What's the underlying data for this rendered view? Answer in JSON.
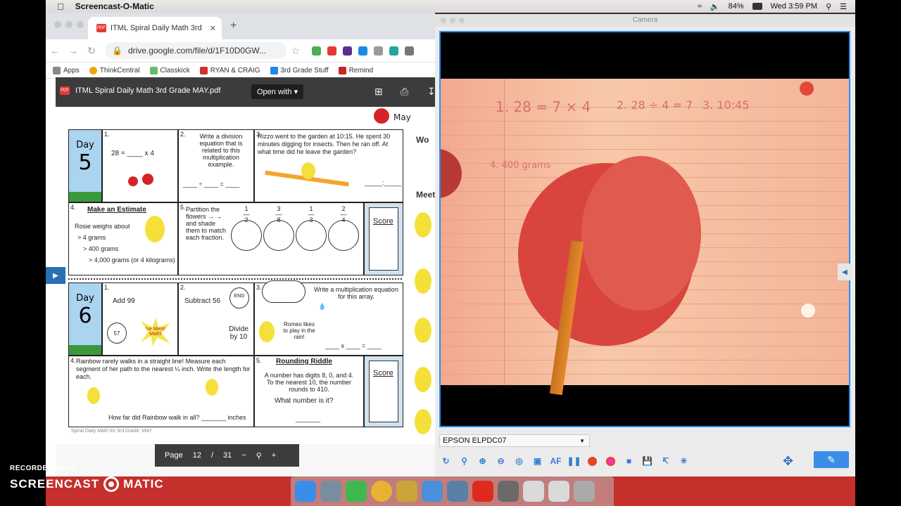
{
  "menubar": {
    "app_name": "Screencast-O-Matic",
    "battery": "84%",
    "clock": "Wed 3:59 PM"
  },
  "browser": {
    "tab_title": "ITML Spiral Daily Math 3rd Gra",
    "url": "drive.google.com/file/d/1F10D0GW...",
    "bookmarks": [
      "Apps",
      "ThinkCentral",
      "Classkick",
      "RYAN & CRAIG",
      "3rd Grade Stuff",
      "Remind"
    ]
  },
  "pdf": {
    "filename": "ITML Spiral Daily Math 3rd Grade MAY.pdf",
    "open_with": "Open with",
    "page_label": "Page",
    "page_current": "12",
    "page_sep": "/",
    "page_total": "31",
    "month": "May",
    "day_label": "Day",
    "day5": "5",
    "day6": "6",
    "p1_num": "1.",
    "p1_text": "28 = ____ x 4",
    "p2_num": "2.",
    "p2_text": "Write a division equation that is related to this multiplication example.",
    "p3_num": "3.",
    "p3_text": "Rizzo went to the garden at 10:15. He spent 30 minutes digging for insects. Then he ran off. At what time did he leave the garden?",
    "p4_num": "4.",
    "p4_title": "Make an Estimate",
    "p4_text": "Rosie weighs about",
    "p4_opt1": "> 4 grams",
    "p4_opt2": "> 400 grams",
    "p4_opt3": "> 4,000 grams (or 4 kilograms)",
    "p5_num": "5.",
    "p5_text": "Partition the flowers → → and shade them to match each fraction.",
    "score": "Score",
    "d6p1_text": "Add 99",
    "d6p1_start": "57",
    "d6p1_mental": "Use Mental Math!",
    "d6p2_text": "Subtract 56",
    "d6p2_end": "END",
    "d6p2_divide": "Divide by 10",
    "d6p3_text": "Write a multiplication equation for this array.",
    "d6p3_romeo": "Romeo likes to play in the rain!",
    "d6p4_text": "Rainbow rarely walks in a straight line! Measure each segment of her path to the nearest ¼ inch. Write the length for each.",
    "d6p4_q": "How far did Rainbow walk in all? _______ inches",
    "d6p5_title": "Rounding Riddle",
    "d6p5_text": "A number has digits 8, 0, and 4. To the nearest 10, the number rounds to 410.",
    "d6p5_q": "What number is it?",
    "footer": "Spiral Daily Math for 3rd Grade: MAY",
    "side_wo": "Wo",
    "side_meet": "Meet"
  },
  "camera": {
    "window_title": "Camera",
    "device": "EPSON ELPDC07",
    "hw1": "1. 28 = 7 × 4",
    "hw2": "2. 28 ÷ 4 = 7",
    "hw3": "3. 10:45",
    "hw4": "4. 400 grams"
  },
  "watermark": {
    "recorded": "RECORDED WITH",
    "brand_left": "SCREENCAST",
    "brand_right": "MATIC"
  },
  "colors": {
    "accent": "#2b8ef0",
    "pdf_red": "#e53935",
    "day_blue": "#aad4f0"
  }
}
